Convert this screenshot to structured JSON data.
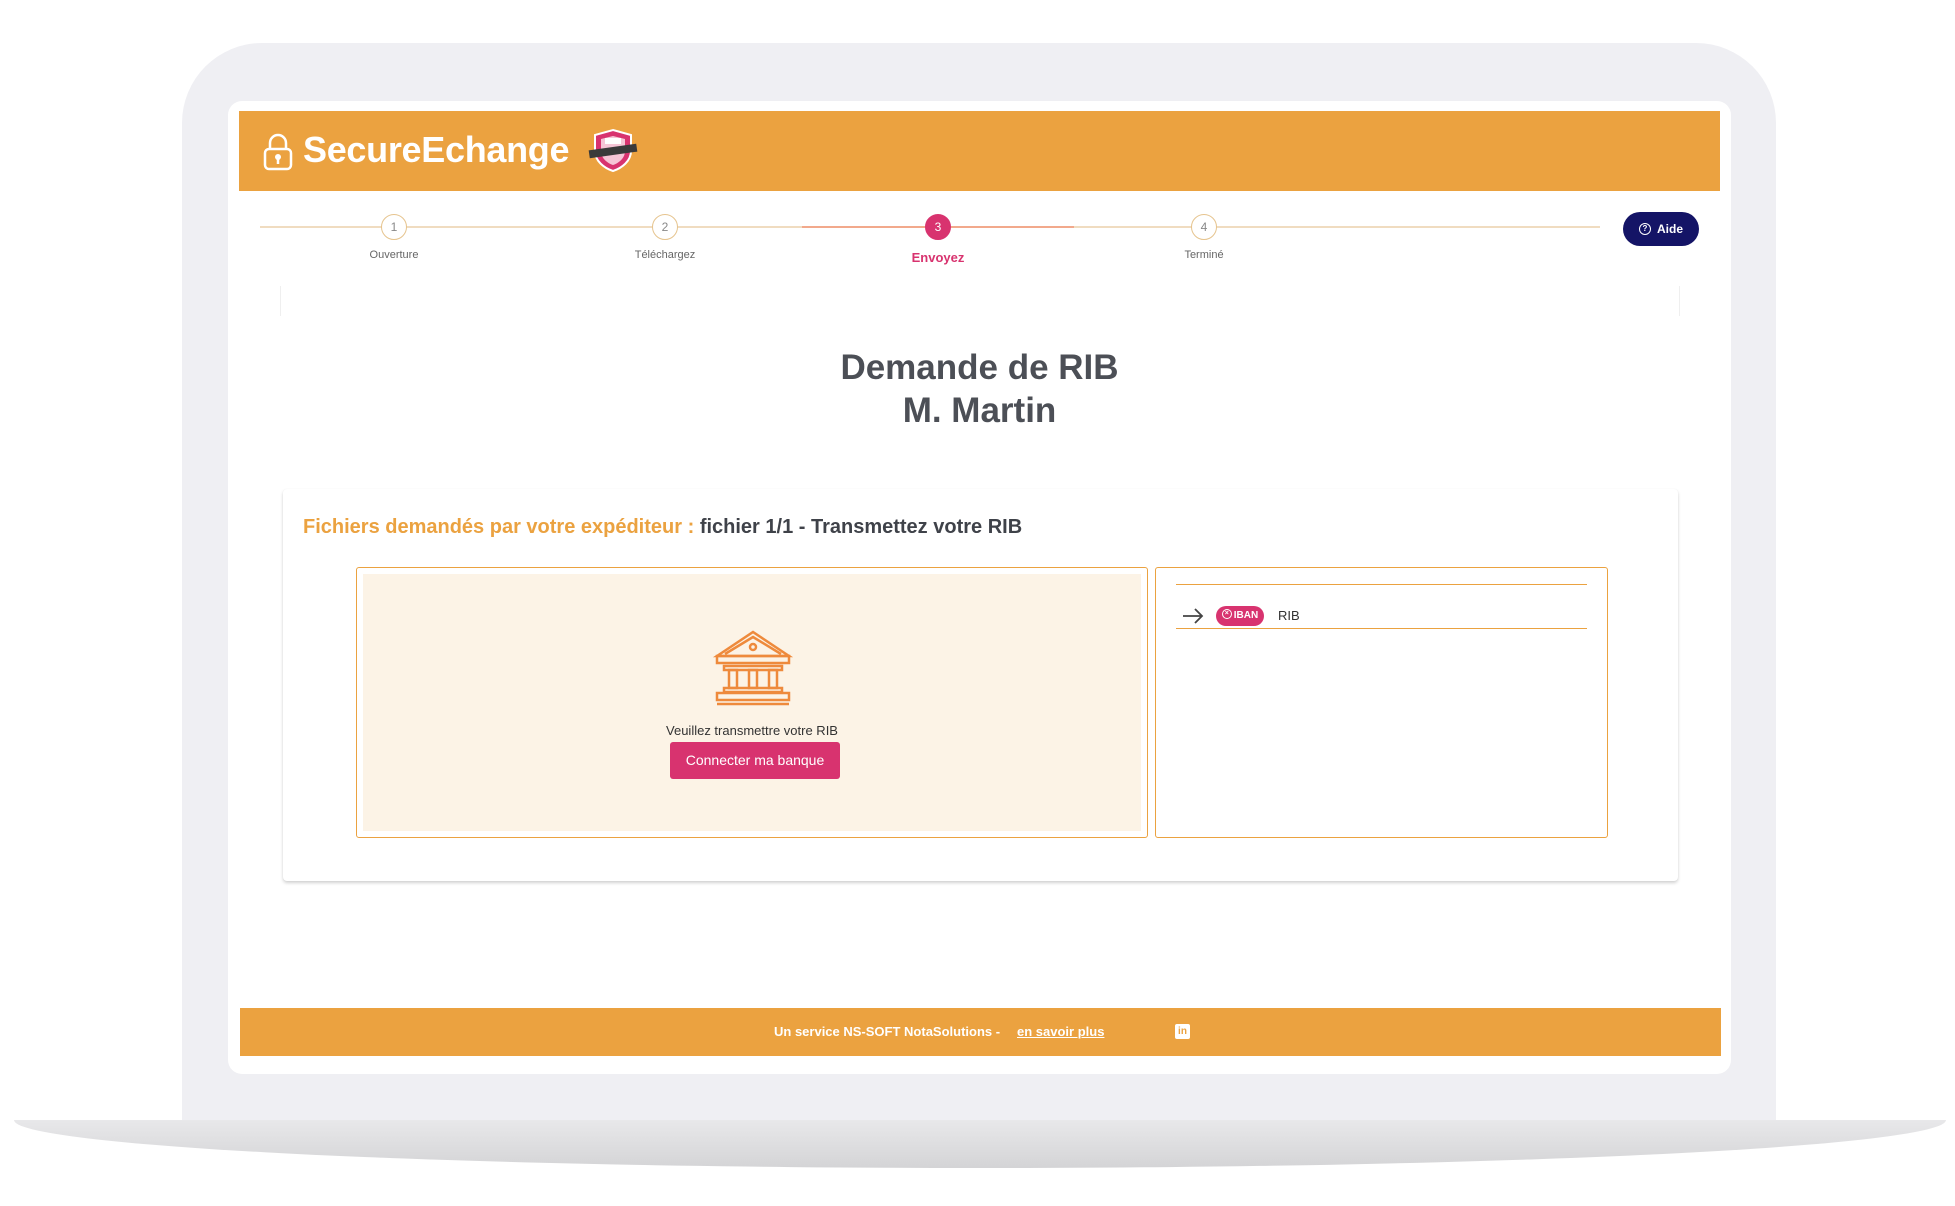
{
  "brand": {
    "name": "SecureEchange"
  },
  "stepper": {
    "steps": [
      {
        "number": "1",
        "label": "Ouverture"
      },
      {
        "number": "2",
        "label": "Téléchargez"
      },
      {
        "number": "3",
        "label": "Envoyez"
      },
      {
        "number": "4",
        "label": "Terminé"
      }
    ],
    "active_step": 3
  },
  "help": {
    "label": "Aide"
  },
  "page": {
    "title_line1": "Demande de RIB",
    "title_line2": "M. Martin"
  },
  "files": {
    "heading_prefix": "Fichiers demandés par votre expéditeur :",
    "heading_file": "fichier 1/1 - Transmettez votre RIB",
    "upload_text": "Veuillez transmettre votre RIB",
    "connect_button": "Connecter ma banque",
    "items": [
      {
        "badge": "IBAN",
        "label": "RIB"
      }
    ]
  },
  "footer": {
    "text": "Un service NS-SOFT NotaSolutions -",
    "link": "en savoir plus"
  },
  "colors": {
    "brand_orange": "#eba240",
    "accent_pink": "#d8336f",
    "help_navy": "#141466",
    "upload_background": "#fcf3e6"
  },
  "icons": [
    "lock-icon",
    "badge-logo-icon",
    "help-icon",
    "bank-icon",
    "arrow-right-icon",
    "iban-close-icon",
    "linkedin-icon"
  ]
}
